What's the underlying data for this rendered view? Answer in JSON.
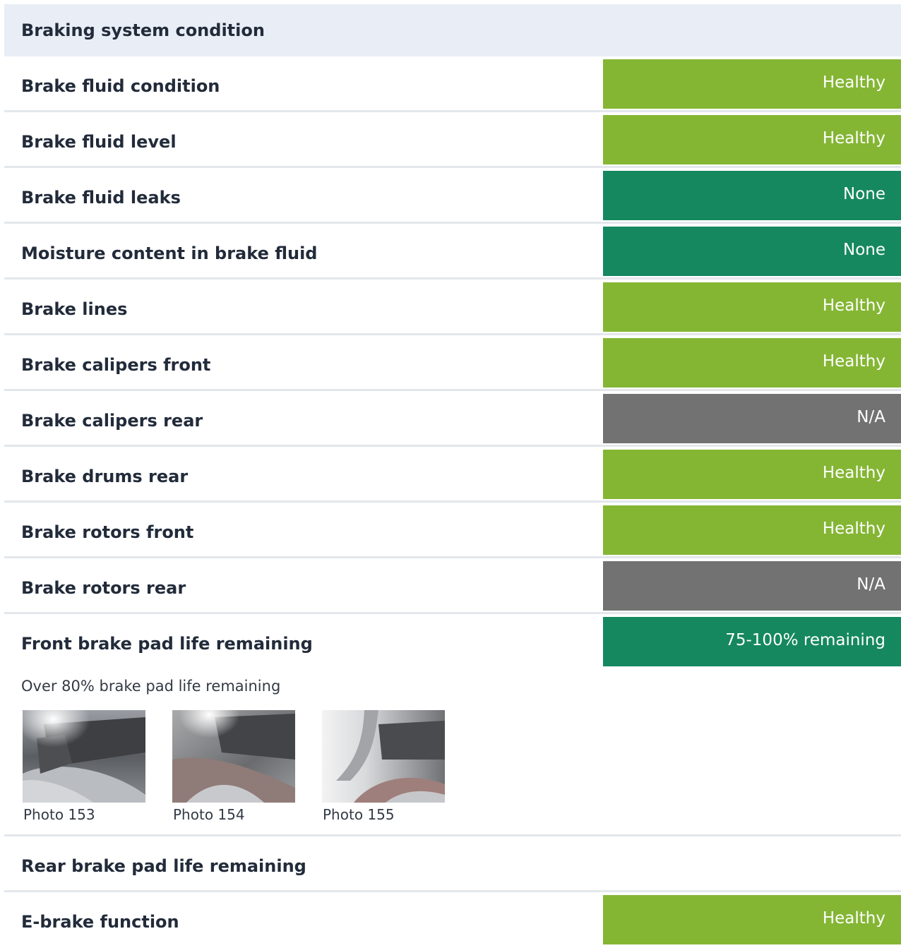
{
  "section": {
    "title": "Braking system condition"
  },
  "rows": [
    {
      "label": "Brake fluid condition",
      "status": "Healthy",
      "kind": "healthy",
      "color": "#84b634"
    },
    {
      "label": "Brake fluid level",
      "status": "Healthy",
      "kind": "healthy",
      "color": "#84b634"
    },
    {
      "label": "Brake fluid leaks",
      "status": "None",
      "kind": "none",
      "color": "#15885f"
    },
    {
      "label": "Moisture content in brake fluid",
      "status": "None",
      "kind": "none",
      "color": "#15885f"
    },
    {
      "label": "Brake lines",
      "status": "Healthy",
      "kind": "healthy",
      "color": "#84b634"
    },
    {
      "label": "Brake calipers front",
      "status": "Healthy",
      "kind": "healthy",
      "color": "#84b634"
    },
    {
      "label": "Brake calipers rear",
      "status": "N/A",
      "kind": "na",
      "color": "#727272"
    },
    {
      "label": "Brake drums rear",
      "status": "Healthy",
      "kind": "healthy",
      "color": "#84b634"
    },
    {
      "label": "Brake rotors front",
      "status": "Healthy",
      "kind": "healthy",
      "color": "#84b634"
    },
    {
      "label": "Brake rotors rear",
      "status": "N/A",
      "kind": "na",
      "color": "#727272"
    }
  ],
  "front_pads": {
    "label": "Front brake pad life remaining",
    "status": "75-100% remaining",
    "color": "#15885f",
    "note": "Over 80% brake pad life remaining",
    "photos": [
      {
        "caption": "Photo 153"
      },
      {
        "caption": "Photo 154"
      },
      {
        "caption": "Photo 155"
      }
    ]
  },
  "rear_pads": {
    "label": "Rear brake pad life remaining"
  },
  "ebrake": {
    "label": "E-brake function",
    "status": "Healthy",
    "color": "#84b634"
  }
}
